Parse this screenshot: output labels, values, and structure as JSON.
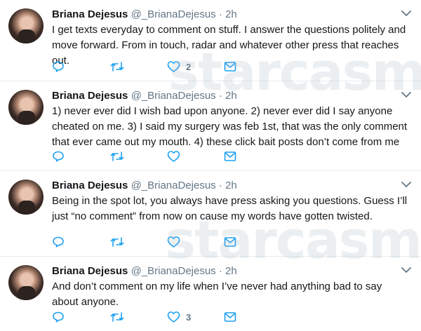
{
  "tweets": [
    {
      "name": "Briana Dejesus",
      "handle": "@_BrianaDejesus",
      "separator": "·",
      "time": "2h",
      "text": "I get texts everyday to comment on stuff. I answer the questions politely and move forward. From in touch, radar and whatever other press that reaches out.",
      "like_count": "2"
    },
    {
      "name": "Briana Dejesus",
      "handle": "@_BrianaDejesus",
      "separator": "·",
      "time": "2h",
      "text": "1) never ever did I wish bad upon anyone. 2) never ever did I say anyone cheated on me. 3) I said my surgery was feb 1st, that was the only comment that ever came out my mouth. 4) these click bait posts don’t come from me",
      "like_count": ""
    },
    {
      "name": "Briana Dejesus",
      "handle": "@_BrianaDejesus",
      "separator": "·",
      "time": "2h",
      "text": "Being in the spot lot, you always have press asking you questions. Guess I’ll just “no comment” from now on cause my words have gotten twisted.",
      "like_count": ""
    },
    {
      "name": "Briana Dejesus",
      "handle": "@_BrianaDejesus",
      "separator": "·",
      "time": "2h",
      "text": "And don’t comment on my life when I’ve never had anything bad to say about anyone.",
      "like_count": "3"
    }
  ],
  "watermark": "starcasm",
  "icons": {
    "reply": "reply-icon",
    "retweet": "retweet-icon",
    "like": "heart-icon",
    "dm": "envelope-icon",
    "menu": "chevron-down-icon"
  },
  "colors": {
    "text": "#14171a",
    "secondary": "#657786",
    "icon": "#1da1f2",
    "divider": "#e6ecf0"
  }
}
